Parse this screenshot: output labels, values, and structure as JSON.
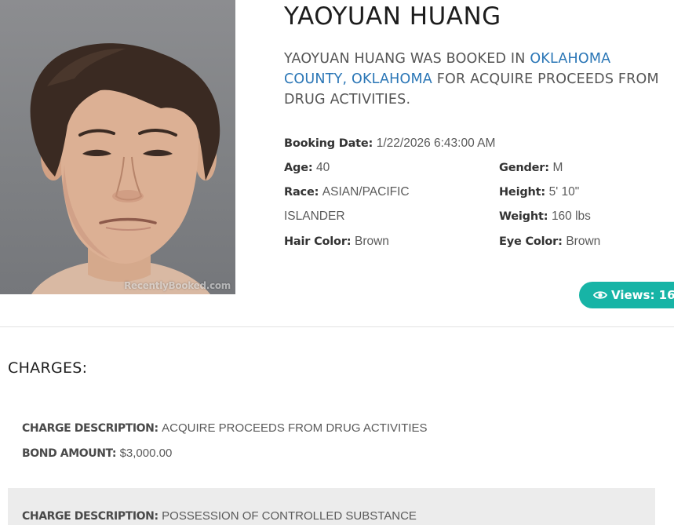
{
  "profile": {
    "name": "YAOYUAN HUANG",
    "watermark": "RecentlyBooked.com",
    "summary_prefix": "YAOYUAN HUANG WAS BOOKED IN",
    "summary_location": "OKLAHOMA COUNTY, OKLAHOMA",
    "summary_suffix": "FOR ACQUIRE PROCEEDS FROM DRUG ACTIVITIES.",
    "link_color": "#2a76b6"
  },
  "details": {
    "booking_date_label": "Booking Date:",
    "booking_date": "1/22/2026 6:43:00 AM",
    "age_label": "Age:",
    "age": "40",
    "gender_label": "Gender:",
    "gender": "M",
    "race_label": "Race:",
    "race_line1": "ASIAN/PACIFIC",
    "race_line2": "ISLANDER",
    "height_label": "Height:",
    "height": "5' 10\"",
    "weight_label": "Weight:",
    "weight": "160 lbs",
    "hair_label": "Hair Color:",
    "hair": "Brown",
    "eye_label": "Eye Color:",
    "eye": "Brown"
  },
  "views": {
    "icon": "eye-icon",
    "label": "Views: 16",
    "color": "#17b4a6"
  },
  "charges": {
    "title": "CHARGES:",
    "items": [
      {
        "desc_label": "CHARGE DESCRIPTION:",
        "desc": "ACQUIRE PROCEEDS FROM DRUG ACTIVITIES",
        "bond_label": "BOND AMOUNT:",
        "bond": "$3,000.00"
      },
      {
        "desc_label": "CHARGE DESCRIPTION:",
        "desc": "POSSESSION OF CONTROLLED SUBSTANCE"
      }
    ]
  }
}
